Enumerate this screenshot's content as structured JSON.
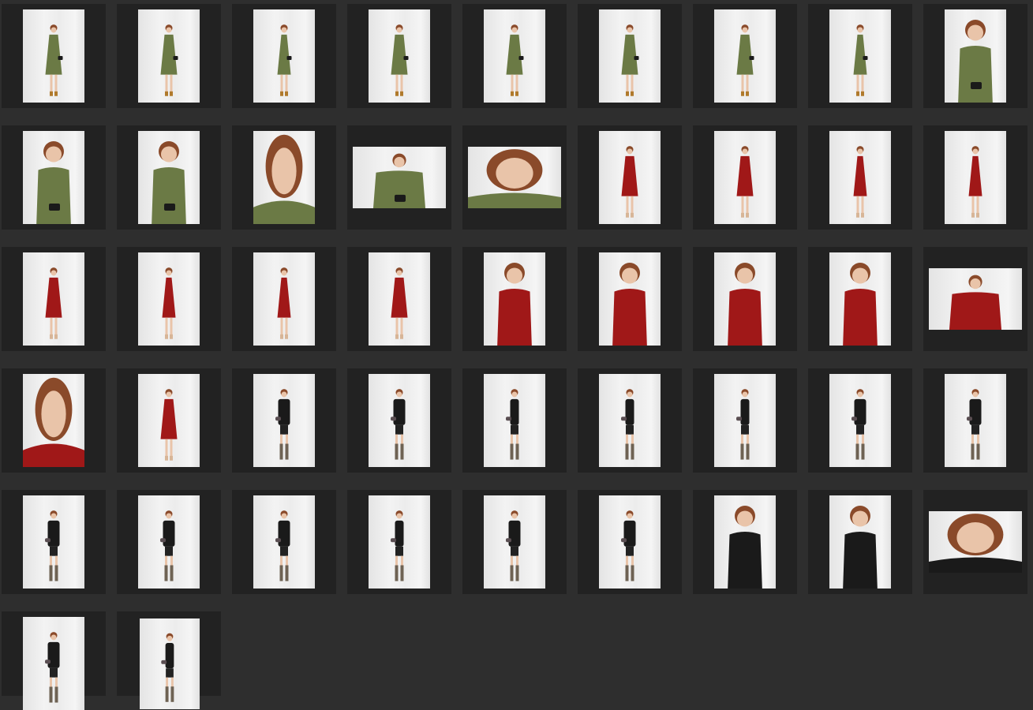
{
  "gallery": {
    "background": "#2e2e2e",
    "cell_color": "#222222",
    "outfit_colors": {
      "green": "#6b7a45",
      "red": "#a01818",
      "black": "#1a1a1a"
    },
    "thumbnails": [
      {
        "outfit": "green",
        "shot": "full",
        "orientation": "portrait",
        "facing": "front"
      },
      {
        "outfit": "green",
        "shot": "full",
        "orientation": "portrait",
        "facing": "front"
      },
      {
        "outfit": "green",
        "shot": "full",
        "orientation": "portrait",
        "facing": "side"
      },
      {
        "outfit": "green",
        "shot": "full",
        "orientation": "portrait",
        "facing": "front"
      },
      {
        "outfit": "green",
        "shot": "full",
        "orientation": "portrait",
        "facing": "back"
      },
      {
        "outfit": "green",
        "shot": "full",
        "orientation": "portrait",
        "facing": "front"
      },
      {
        "outfit": "green",
        "shot": "full",
        "orientation": "portrait",
        "facing": "front"
      },
      {
        "outfit": "green",
        "shot": "full",
        "orientation": "portrait",
        "facing": "side"
      },
      {
        "outfit": "green",
        "shot": "half",
        "orientation": "portrait",
        "facing": "front"
      },
      {
        "outfit": "green",
        "shot": "half",
        "orientation": "portrait",
        "facing": "front"
      },
      {
        "outfit": "green",
        "shot": "half",
        "orientation": "portrait",
        "facing": "front"
      },
      {
        "outfit": "green",
        "shot": "closeup",
        "orientation": "portrait",
        "facing": "front"
      },
      {
        "outfit": "green",
        "shot": "half",
        "orientation": "landscape",
        "facing": "side"
      },
      {
        "outfit": "green",
        "shot": "closeup",
        "orientation": "landscape",
        "facing": "front"
      },
      {
        "outfit": "red",
        "shot": "full",
        "orientation": "portrait",
        "facing": "front"
      },
      {
        "outfit": "red",
        "shot": "full",
        "orientation": "portrait",
        "facing": "front"
      },
      {
        "outfit": "red",
        "shot": "full",
        "orientation": "portrait",
        "facing": "side"
      },
      {
        "outfit": "red",
        "shot": "full",
        "orientation": "portrait",
        "facing": "side"
      },
      {
        "outfit": "red",
        "shot": "full",
        "orientation": "portrait",
        "facing": "back"
      },
      {
        "outfit": "red",
        "shot": "full",
        "orientation": "portrait",
        "facing": "side"
      },
      {
        "outfit": "red",
        "shot": "full",
        "orientation": "portrait",
        "facing": "side"
      },
      {
        "outfit": "red",
        "shot": "full",
        "orientation": "portrait",
        "facing": "front"
      },
      {
        "outfit": "red",
        "shot": "half",
        "orientation": "portrait",
        "facing": "front"
      },
      {
        "outfit": "red",
        "shot": "half",
        "orientation": "portrait",
        "facing": "front"
      },
      {
        "outfit": "red",
        "shot": "half",
        "orientation": "portrait",
        "facing": "side"
      },
      {
        "outfit": "red",
        "shot": "half",
        "orientation": "portrait",
        "facing": "side"
      },
      {
        "outfit": "red",
        "shot": "half",
        "orientation": "landscape",
        "facing": "front"
      },
      {
        "outfit": "red",
        "shot": "closeup",
        "orientation": "portrait",
        "facing": "front"
      },
      {
        "outfit": "red",
        "shot": "full",
        "orientation": "portrait",
        "facing": "front"
      },
      {
        "outfit": "black",
        "shot": "full",
        "orientation": "portrait",
        "facing": "front"
      },
      {
        "outfit": "black",
        "shot": "full",
        "orientation": "portrait",
        "facing": "front"
      },
      {
        "outfit": "black",
        "shot": "full",
        "orientation": "portrait",
        "facing": "side"
      },
      {
        "outfit": "black",
        "shot": "full",
        "orientation": "portrait",
        "facing": "side"
      },
      {
        "outfit": "black",
        "shot": "full",
        "orientation": "portrait",
        "facing": "side"
      },
      {
        "outfit": "black",
        "shot": "full",
        "orientation": "portrait",
        "facing": "back"
      },
      {
        "outfit": "black",
        "shot": "full",
        "orientation": "portrait",
        "facing": "front"
      },
      {
        "outfit": "black",
        "shot": "full",
        "orientation": "portrait",
        "facing": "front"
      },
      {
        "outfit": "black",
        "shot": "full",
        "orientation": "portrait",
        "facing": "front"
      },
      {
        "outfit": "black",
        "shot": "full",
        "orientation": "portrait",
        "facing": "front"
      },
      {
        "outfit": "black",
        "shot": "full",
        "orientation": "portrait",
        "facing": "side"
      },
      {
        "outfit": "black",
        "shot": "full",
        "orientation": "portrait",
        "facing": "front"
      },
      {
        "outfit": "black",
        "shot": "full",
        "orientation": "portrait",
        "facing": "front"
      },
      {
        "outfit": "black",
        "shot": "half",
        "orientation": "portrait",
        "facing": "front"
      },
      {
        "outfit": "black",
        "shot": "half",
        "orientation": "portrait",
        "facing": "front"
      },
      {
        "outfit": "black",
        "shot": "closeup",
        "orientation": "landscape",
        "facing": "front"
      },
      {
        "outfit": "black",
        "shot": "full",
        "orientation": "portrait",
        "facing": "front"
      },
      {
        "outfit": "black",
        "shot": "full",
        "orientation": "crop-portrait",
        "facing": "side"
      }
    ]
  }
}
